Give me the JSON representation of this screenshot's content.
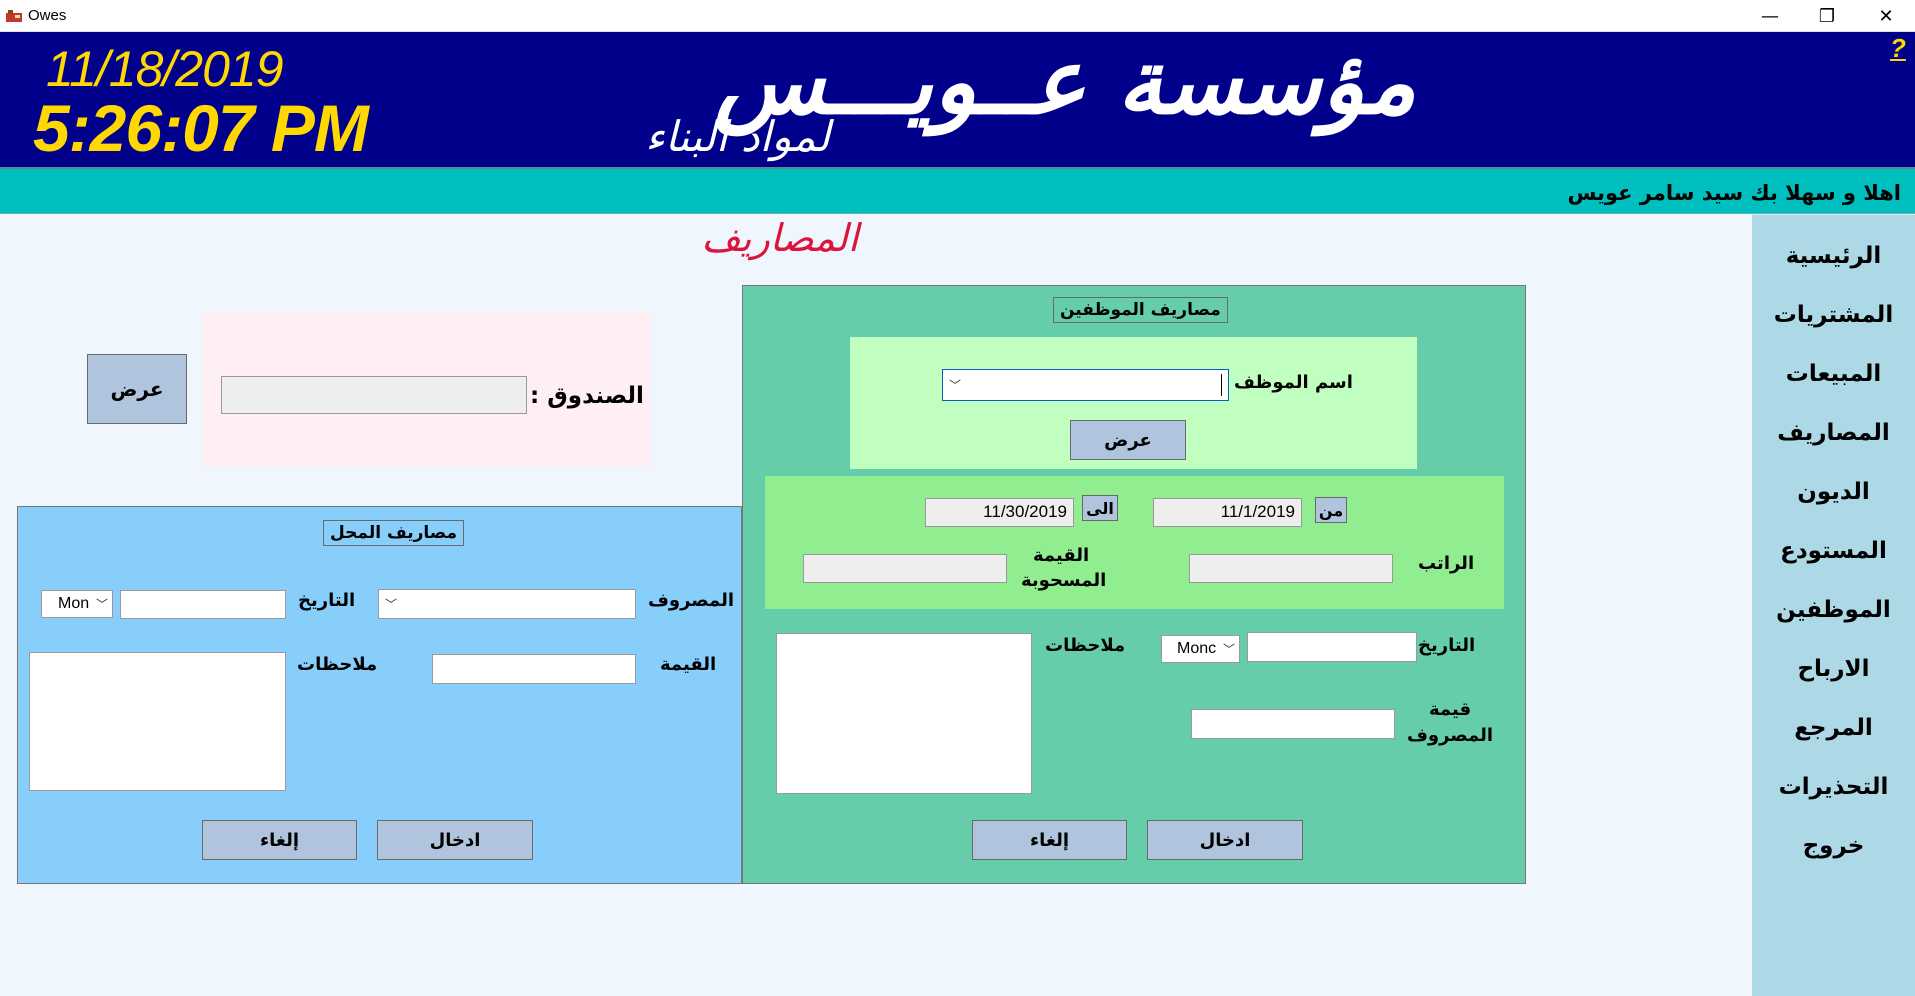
{
  "window": {
    "title": "Owes",
    "minimize_glyph": "—",
    "restore_glyph": "❐",
    "close_glyph": "✕"
  },
  "header": {
    "date": "11/18/2019",
    "time": "5:26:07 PM",
    "company_name": "مؤسسة عــويـــس",
    "company_sub": "لمواد البناء",
    "help": "?"
  },
  "welcome": "اهلا و سهلا بك سيد سامر عويس",
  "sidebar": {
    "items": [
      {
        "label": "الرئيسية"
      },
      {
        "label": "المشتريات"
      },
      {
        "label": "المبيعات"
      },
      {
        "label": "المصاريف"
      },
      {
        "label": "الديون"
      },
      {
        "label": "المستودع"
      },
      {
        "label": "الموظفين"
      },
      {
        "label": "الارباح"
      },
      {
        "label": "المرجع"
      },
      {
        "label": "التحذيرات"
      },
      {
        "label": "خروج"
      }
    ]
  },
  "page_title": "المصاريف",
  "cash": {
    "label": "الصندوق :",
    "value": "",
    "show_button": "عرض"
  },
  "shop": {
    "title": "مصاريف المحل",
    "expense_label": "المصروف",
    "expense_value": "",
    "date_label": "التاريخ",
    "date_value": "",
    "date_combo": "Mon",
    "amount_label": "القيمة",
    "amount_value": "",
    "notes_label": "ملاحظات",
    "notes_value": "",
    "enter_button": "ادخال",
    "cancel_button": "إلغاء"
  },
  "employee": {
    "title": "مصاريف الموظفين",
    "name_label": "اسم الموظف",
    "name_value": "",
    "show_button": "عرض",
    "from_label": "من",
    "from_date": "11/1/2019",
    "to_label": "الى",
    "to_date": "11/30/2019",
    "salary_label": "الراتب",
    "salary_value": "",
    "withdrawn_label_1": "القيمة",
    "withdrawn_label_2": "المسحوبة",
    "withdrawn_value": "",
    "date_label": "التاريخ",
    "date_value": "",
    "date_combo": "Monc",
    "notes_label": "ملاحظات",
    "notes_value": "",
    "expense_value_label_1": "قيمة",
    "expense_value_label_2": "المصروف",
    "expense_value": "",
    "enter_button": "ادخال",
    "cancel_button": "إلغاء"
  },
  "colors": {
    "header_bg": "#00008b",
    "header_text": "#ffd800",
    "welcome_bg": "#00bfbf",
    "sidebar_bg": "#add8e6",
    "title_color": "#dc143c",
    "shop_panel": "#87cefa",
    "employee_panel": "#66cdaa",
    "button_bg": "#b0c4de"
  }
}
